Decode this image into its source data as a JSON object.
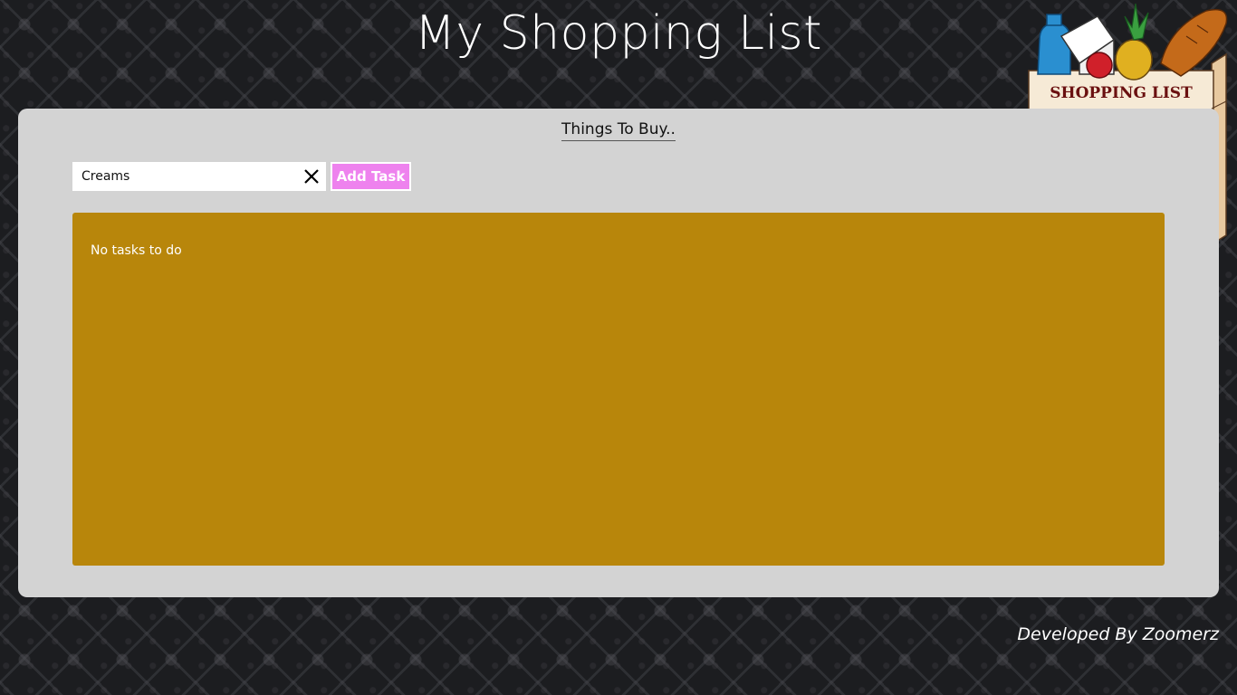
{
  "app": {
    "title": "My Shopping List"
  },
  "logo": {
    "text": "SHOPPING LIST",
    "icon": "shopping-bag-with-groceries"
  },
  "panel": {
    "heading": "Things To Buy..",
    "input": {
      "value": "Creams",
      "placeholder": "",
      "clear_icon": "close-icon"
    },
    "add_button_label": "Add Task",
    "task_list": {
      "items": [],
      "empty_message": "No tasks to do"
    }
  },
  "footer": {
    "credit": "Developed By Zoomerz"
  },
  "colors": {
    "panel_background": "#d3d3d3",
    "task_list_background": "#b8860b",
    "add_button_background": "#ee82ee",
    "page_background": "#1c1d20"
  }
}
